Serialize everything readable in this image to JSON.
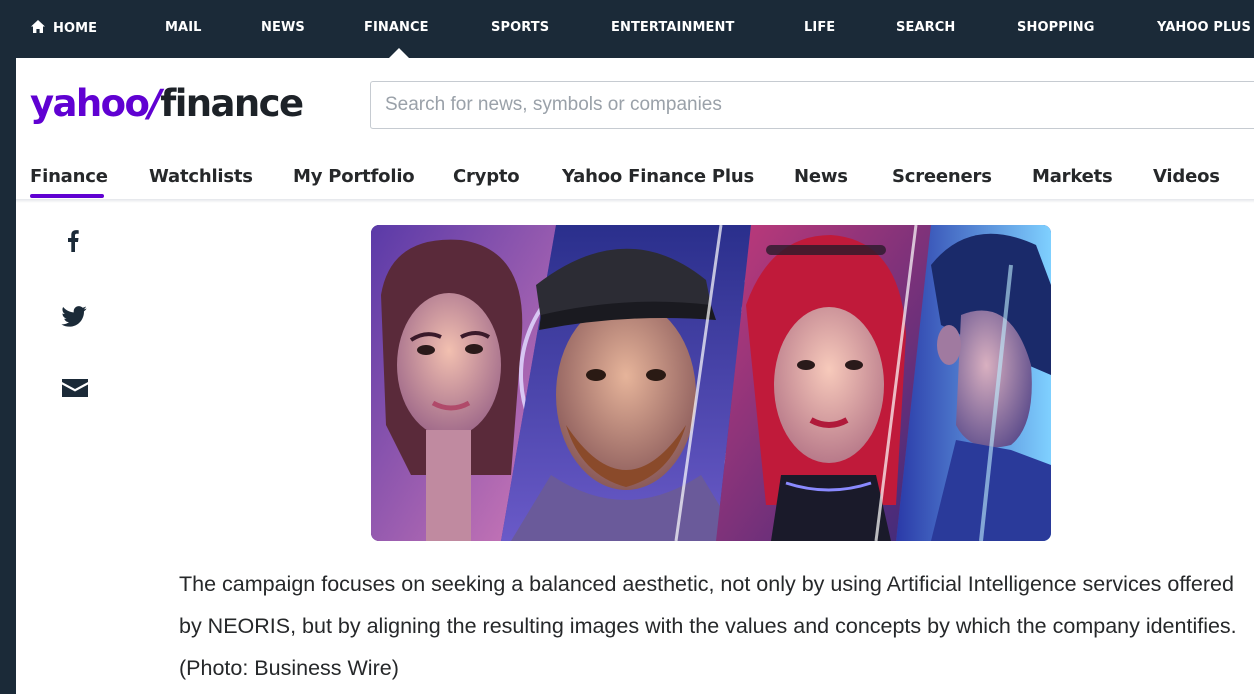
{
  "topnav": {
    "items": [
      {
        "label": "HOME"
      },
      {
        "label": "MAIL"
      },
      {
        "label": "NEWS"
      },
      {
        "label": "FINANCE"
      },
      {
        "label": "SPORTS"
      },
      {
        "label": "ENTERTAINMENT"
      },
      {
        "label": "LIFE"
      },
      {
        "label": "SEARCH"
      },
      {
        "label": "SHOPPING"
      },
      {
        "label": "YAHOO PLUS"
      }
    ],
    "active": "FINANCE"
  },
  "logo": {
    "yahoo": "yahoo",
    "slash": "/",
    "finance": "finance"
  },
  "search": {
    "placeholder": "Search for news, symbols or companies"
  },
  "subnav": {
    "items": [
      {
        "label": "Finance"
      },
      {
        "label": "Watchlists"
      },
      {
        "label": "My Portfolio"
      },
      {
        "label": "Crypto"
      },
      {
        "label": "Yahoo Finance Plus"
      },
      {
        "label": "News"
      },
      {
        "label": "Screeners"
      },
      {
        "label": "Markets"
      },
      {
        "label": "Videos"
      }
    ],
    "active": "Finance"
  },
  "share": {
    "icons": [
      "facebook-icon",
      "twitter-icon",
      "mail-icon"
    ]
  },
  "article": {
    "caption": "The campaign focuses on seeking a balanced aesthetic, not only by using Artificial Intelligence services offered by NEORIS, but by aligning the resulting images with the values and concepts by which the company identifies. (Photo: Business Wire)"
  },
  "colors": {
    "nav_bg": "#1b2a38",
    "brand_purple": "#6001d2",
    "text": "#26282a"
  }
}
